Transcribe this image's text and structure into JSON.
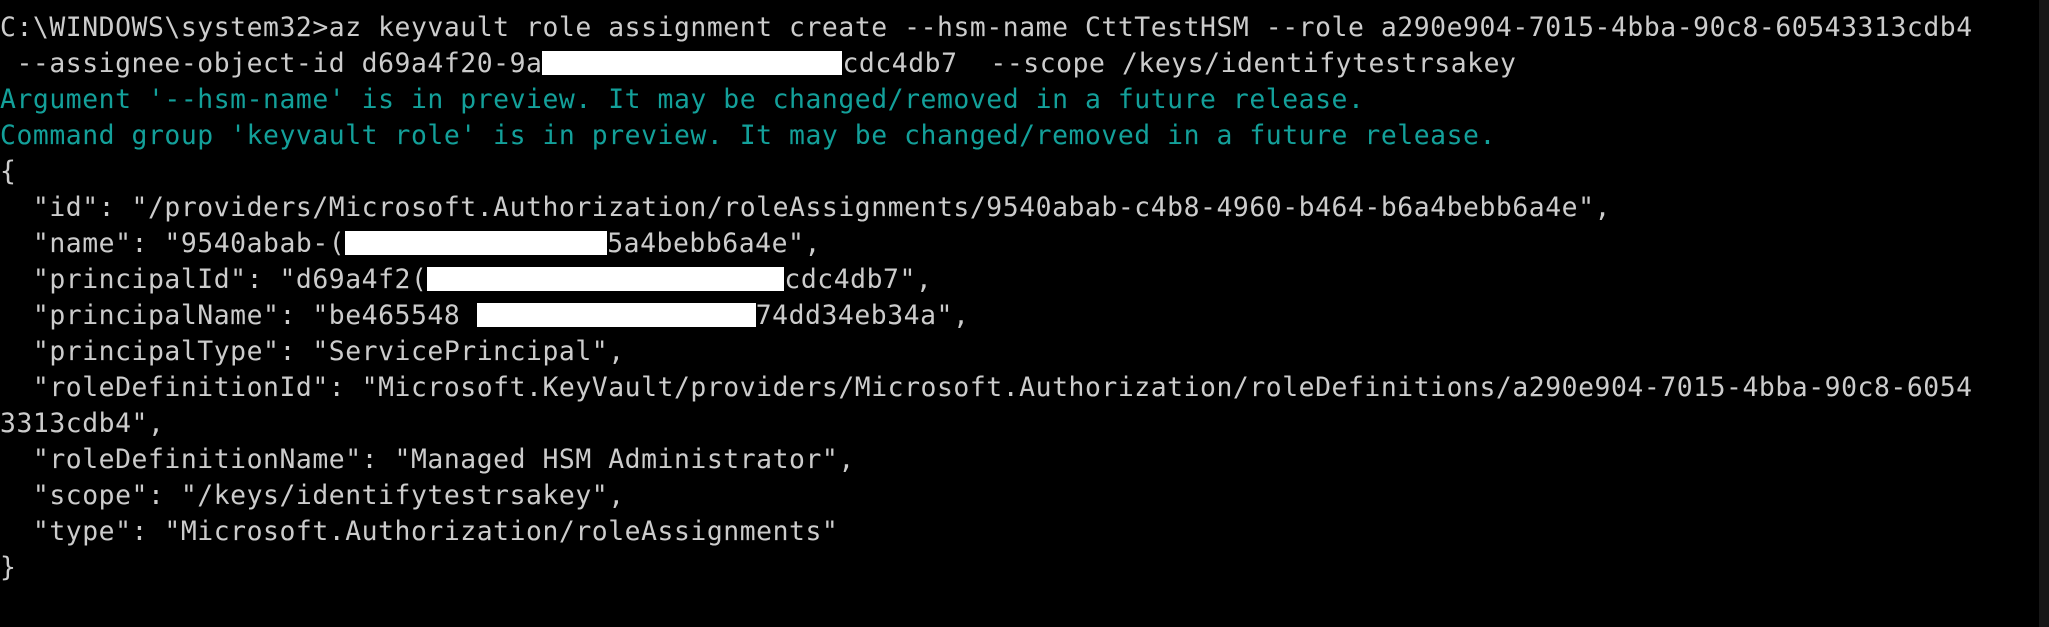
{
  "window": {
    "type": "command-prompt",
    "prompt": "C:\\WINDOWS\\system32>"
  },
  "command": {
    "line1": "az keyvault role assignment create --hsm-name CttTestHSM --role a290e904-7015-4bba-90c8-60543313cdb4",
    "line2_before_redaction": " --assignee-object-id d69a4f20-9a",
    "line2_after_redaction": "cdc4db7  --scope /keys/identifytestrsakey"
  },
  "warnings": [
    "Argument '--hsm-name' is in preview. It may be changed/removed in a future release.",
    "Command group 'keyvault role' is in preview. It may be changed/removed in a future release."
  ],
  "output": {
    "open_brace": "{",
    "id_line": "  \"id\": \"/providers/Microsoft.Authorization/roleAssignments/9540abab-c4b8-4960-b464-b6a4bebb6a4e\",",
    "name_before": "  \"name\": \"9540abab-(",
    "name_after": "5a4bebb6a4e\",",
    "principalId_before": "  \"principalId\": \"d69a4f2(",
    "principalId_after": "cdc4db7\",",
    "principalName_before": "  \"principalName\": \"be465548 ",
    "principalName_after": "74dd34eb34a\",",
    "principalType_line": "  \"principalType\": \"ServicePrincipal\",",
    "roleDefinitionId_line": "  \"roleDefinitionId\": \"Microsoft.KeyVault/providers/Microsoft.Authorization/roleDefinitions/a290e904-7015-4bba-90c8-6054",
    "roleDefinitionId_wrap": "3313cdb4\",",
    "roleDefinitionName_line": "  \"roleDefinitionName\": \"Managed HSM Administrator\",",
    "scope_line": "  \"scope\": \"/keys/identifytestrsakey\",",
    "type_line": "  \"type\": \"Microsoft.Authorization/roleAssignments\"",
    "close_brace": "}"
  },
  "colors": {
    "background": "#000000",
    "text": "#cccccc",
    "warning": "#13a09a",
    "redaction": "#ffffff",
    "scrollbar": "#171717"
  }
}
